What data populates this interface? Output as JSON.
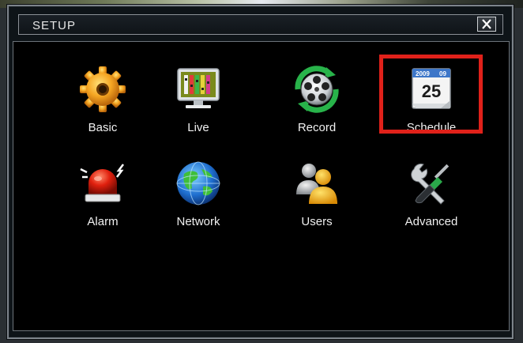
{
  "window": {
    "title": "SETUP",
    "close_icon": "close-icon"
  },
  "menu": {
    "items": [
      {
        "id": "basic",
        "label": "Basic",
        "icon": "gear-icon"
      },
      {
        "id": "live",
        "label": "Live",
        "icon": "monitor-icon"
      },
      {
        "id": "record",
        "label": "Record",
        "icon": "film-reel-icon"
      },
      {
        "id": "schedule",
        "label": "Schedule",
        "icon": "calendar-icon",
        "selected": true
      },
      {
        "id": "alarm",
        "label": "Alarm",
        "icon": "alarm-light-icon"
      },
      {
        "id": "network",
        "label": "Network",
        "icon": "globe-icon"
      },
      {
        "id": "users",
        "label": "Users",
        "icon": "users-icon"
      },
      {
        "id": "advanced",
        "label": "Advanced",
        "icon": "tools-icon"
      }
    ]
  },
  "calendar": {
    "year": "2009",
    "month": "09",
    "day": "25"
  },
  "colors": {
    "highlight": "#e0211a",
    "background": "#000000"
  }
}
